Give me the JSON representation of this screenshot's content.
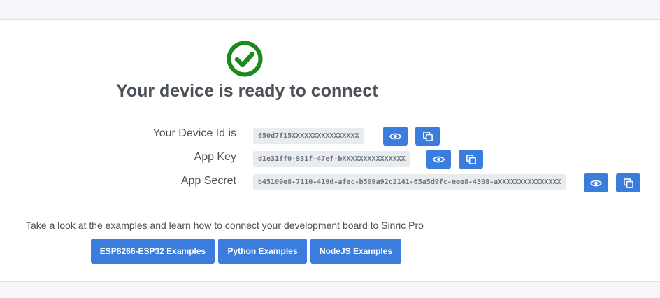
{
  "header": {
    "success_icon": "check-circle-icon",
    "title": "Your device is ready to connect"
  },
  "credentials": [
    {
      "label": "Your Device Id is",
      "value": "650d7f15XXXXXXXXXXXXXXXX",
      "reveal_icon": "eye-icon",
      "copy_icon": "copy-icon"
    },
    {
      "label": "App Key",
      "value": "d1e31ff0-931f-47ef-bXXXXXXXXXXXXXXX",
      "reveal_icon": "eye-icon",
      "copy_icon": "copy-icon"
    },
    {
      "label": "App Secret",
      "value": "b45109e8-7110-419d-afec-b509a92c2141-65a5d9fc-eee8-4308-aXXXXXXXXXXXXXXX",
      "reveal_icon": "eye-icon",
      "copy_icon": "copy-icon"
    }
  ],
  "examples": {
    "intro": "Take a look at the examples and learn how to connect your development board to Sinric Pro",
    "buttons": [
      "ESP8266-ESP32 Examples",
      "Python Examples",
      "NodeJS Examples"
    ]
  },
  "colors": {
    "primary": "#3b7ddd",
    "success": "#1a8a1a",
    "code_background": "#e9ecef"
  }
}
